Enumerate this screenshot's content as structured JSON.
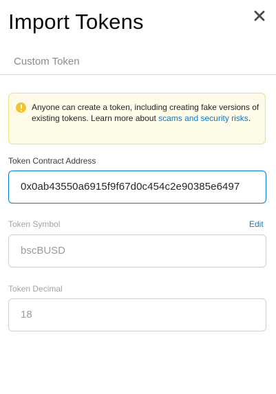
{
  "header": {
    "title": "Import Tokens"
  },
  "tabs": [
    {
      "label": "Custom Token"
    }
  ],
  "warning": {
    "text": "Anyone can create a token, including creating fake versions of existing tokens. Learn more about ",
    "link_text": "scams and security risks",
    "suffix": ".",
    "icon": "warning-icon"
  },
  "form": {
    "address": {
      "label": "Token Contract Address",
      "value": "0x0ab43550a6915f9f67d0c454c2e90385e6497"
    },
    "symbol": {
      "label": "Token Symbol",
      "edit_label": "Edit",
      "value": "bscBUSD"
    },
    "decimal": {
      "label": "Token Decimal",
      "value": "18"
    }
  },
  "colors": {
    "accent": "#037dd6",
    "warning_bg": "#fefae8",
    "warning_border": "#f3dc7f",
    "warning_icon": "#f2c230"
  }
}
